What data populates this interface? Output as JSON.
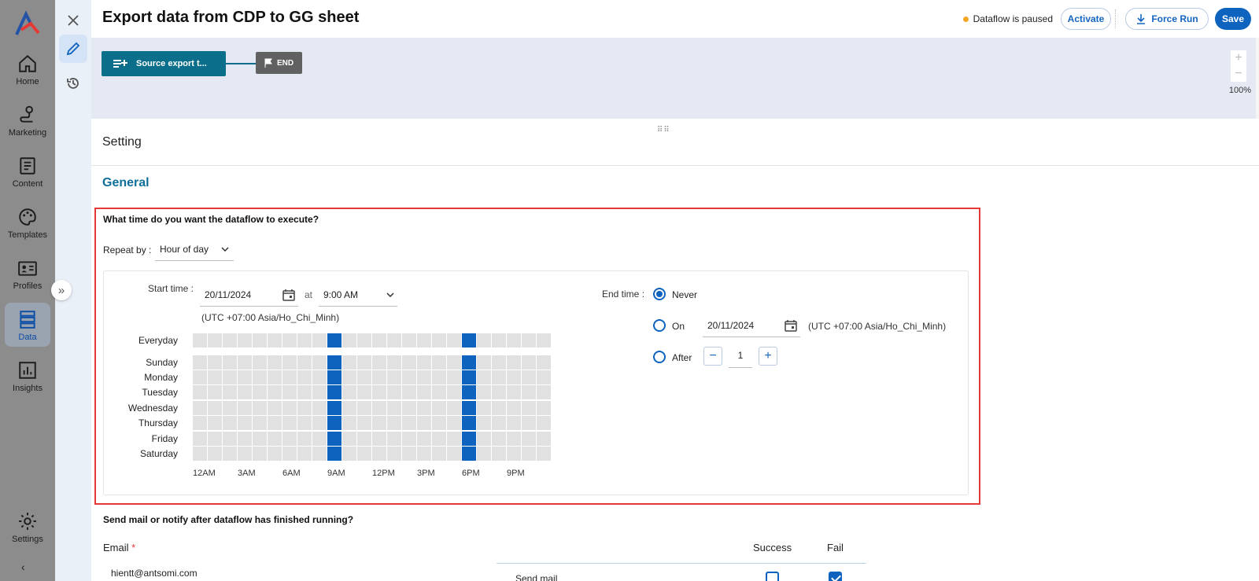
{
  "nav": {
    "items": [
      {
        "label": "Home",
        "icon": "home-icon"
      },
      {
        "label": "Marketing",
        "icon": "marketing-icon"
      },
      {
        "label": "Content",
        "icon": "content-icon"
      },
      {
        "label": "Templates",
        "icon": "palette-icon"
      },
      {
        "label": "Profiles",
        "icon": "profile-card-icon"
      },
      {
        "label": "Data",
        "icon": "database-icon",
        "active": true
      },
      {
        "label": "Insights",
        "icon": "chart-icon"
      },
      {
        "label": "Settings",
        "icon": "gear-icon"
      }
    ],
    "collapse_glyph": "‹",
    "expand_glyph": "»"
  },
  "header": {
    "title": "Export data from CDP to GG sheet",
    "status": "Dataflow is paused",
    "status_color": "#f5a623",
    "activate_label": "Activate",
    "force_run_label": "Force Run",
    "save_label": "Save"
  },
  "canvas": {
    "source_node": "Source export t...",
    "end_node": "END",
    "zoom_in": "+",
    "zoom_out": "−",
    "zoom_level": "100%"
  },
  "setting": {
    "title": "Setting",
    "section": "General",
    "question": "What time do you want the dataflow to execute?",
    "repeat_label": "Repeat by :",
    "repeat_value": "Hour of day",
    "start_label": "Start time :",
    "start_date": "20/11/2024",
    "at_label": "at",
    "start_time": "9:00 AM",
    "timezone": "(UTC +07:00 Asia/Ho_Chi_Minh)",
    "end_label": "End time :",
    "end_options": {
      "never": "Never",
      "on": "On",
      "after": "After"
    },
    "end_selected": "never",
    "end_date": "20/11/2024",
    "end_timezone": "(UTC +07:00 Asia/Ho_Chi_Minh)",
    "after_value": "1",
    "stepper_minus": "−",
    "stepper_plus": "+"
  },
  "schedule": {
    "rows": [
      "Everyday",
      "Sunday",
      "Monday",
      "Tuesday",
      "Wednesday",
      "Thursday",
      "Friday",
      "Saturday"
    ],
    "hour_labels": [
      "12AM",
      "3AM",
      "6AM",
      "9AM",
      "12PM",
      "3PM",
      "6PM",
      "9PM"
    ],
    "active_hours": [
      9,
      18
    ],
    "active_color": "#0d63be",
    "inactive_color": "#e1e1e1"
  },
  "notify": {
    "question": "Send mail or notify after dataflow has finished running?",
    "email_label": "Email",
    "required_mark": "*",
    "email_value": "hientt@antsomi.com",
    "success_label": "Success",
    "fail_label": "Fail",
    "send_mail_label": "Send mail",
    "send_mail_success": false,
    "send_mail_fail": true
  }
}
